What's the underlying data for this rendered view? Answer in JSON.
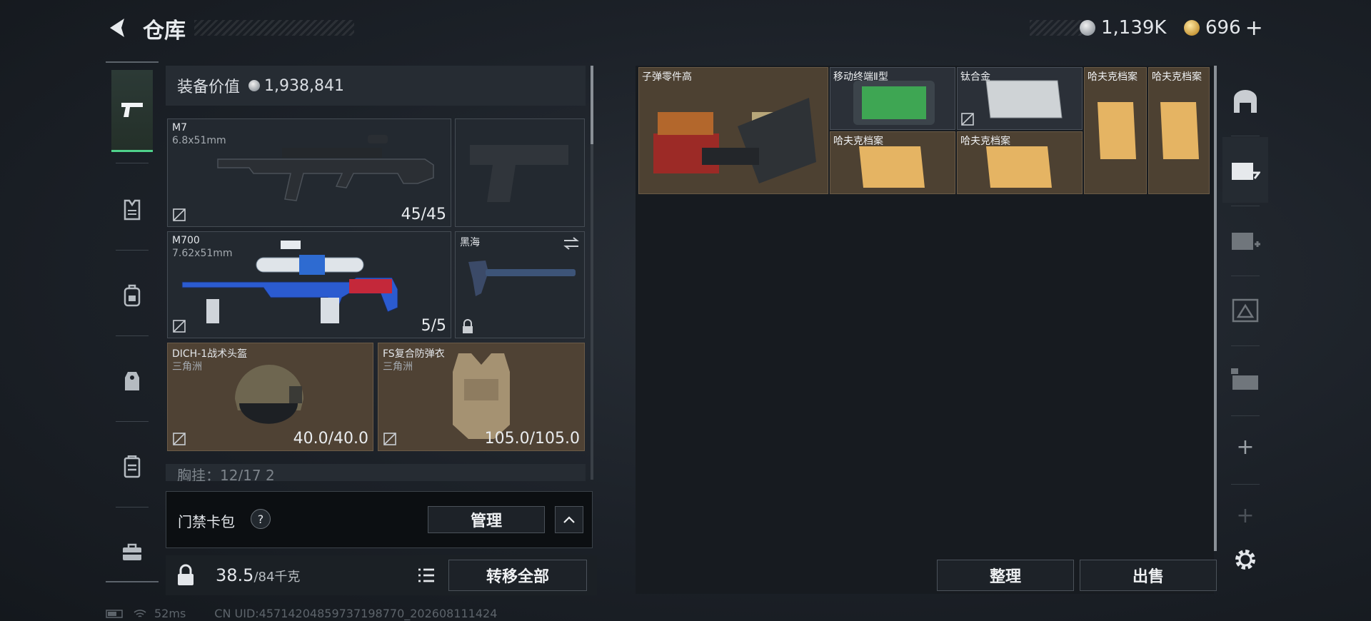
{
  "header": {
    "title": "仓库"
  },
  "currency": {
    "silver": "1,139K",
    "gold": "696",
    "plus": "+"
  },
  "left_sidebar": {
    "tabs": [
      "weapons",
      "armor",
      "backpack",
      "chest-rig",
      "container",
      "case"
    ]
  },
  "equipment": {
    "value_label": "装备价值",
    "value": "1,938,841",
    "slots": [
      {
        "name": "M7",
        "sub": "6.8x51mm",
        "count": "45/45"
      },
      {
        "name": "",
        "sub": "",
        "count": ""
      },
      {
        "name": "M700",
        "sub": "7.62x51mm",
        "count": "5/5"
      },
      {
        "name": "黑海",
        "sub": "",
        "count": ""
      },
      {
        "name": "DICH-1战术头盔",
        "sub": "三角洲",
        "count": "40.0/40.0"
      },
      {
        "name": "FS复合防弹衣",
        "sub": "三角洲",
        "count": "105.0/105.0"
      }
    ],
    "partial_row": "胸挂：12/17   2"
  },
  "keycase": {
    "label": "门禁卡包",
    "help": "?",
    "manage": "管理"
  },
  "footer": {
    "weight": "38.5",
    "weight_max": "/84千克",
    "transfer_all": "转移全部"
  },
  "stash": {
    "items": [
      {
        "name": "子弹零件高"
      },
      {
        "name": "移动终端Ⅱ型"
      },
      {
        "name": "钛合金"
      },
      {
        "name": "哈夫克档案"
      },
      {
        "name": "哈夫克档案"
      },
      {
        "name": "哈夫克档案"
      },
      {
        "name": "哈夫克档案"
      }
    ],
    "sort_label": "整理",
    "sell_label": "出售"
  },
  "status_bar": {
    "ping": "52ms",
    "uid": "CN UID:457142048597371987​70_202608111424"
  },
  "colors": {
    "accent_green": "#4fd18b",
    "tan": "#4d4132"
  }
}
